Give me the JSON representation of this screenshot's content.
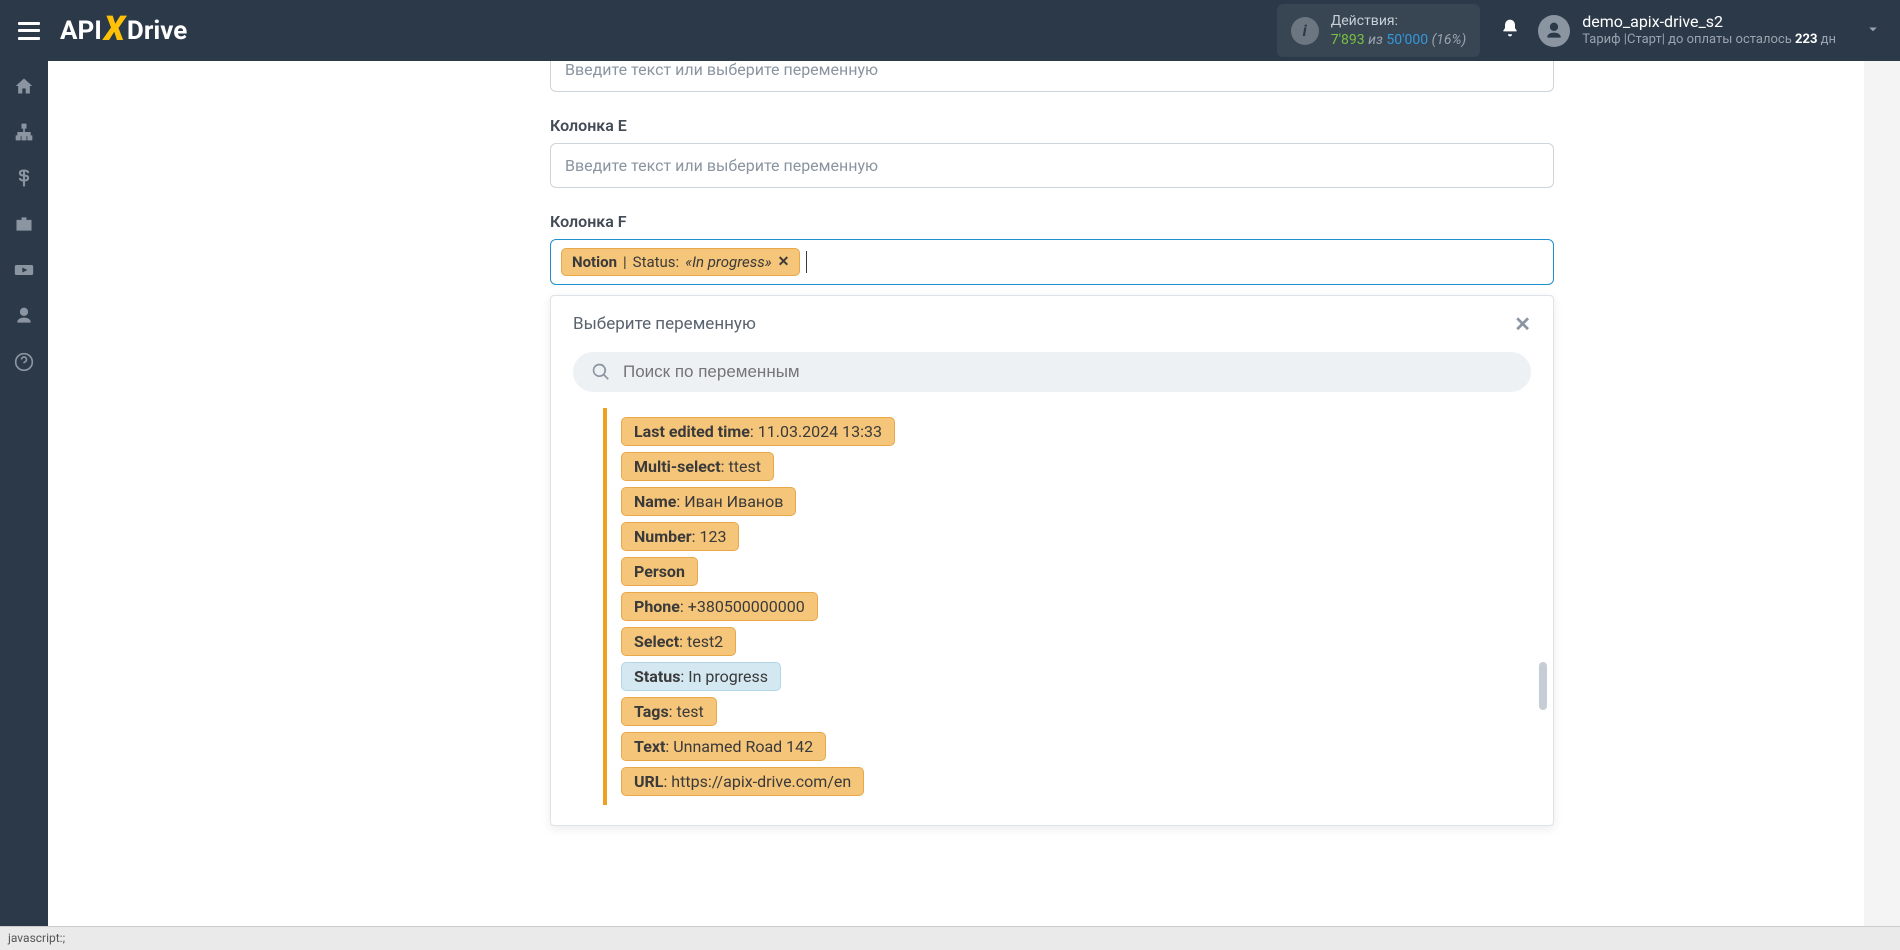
{
  "header": {
    "logo": {
      "part1": "API",
      "part2": "X",
      "part3": "Drive"
    },
    "actions": {
      "label": "Действия:",
      "used": "7'893",
      "iz": "из",
      "total": "50'000",
      "pct": "(16%)"
    },
    "user": {
      "name": "demo_apix-drive_s2",
      "tariff_prefix": "Тариф |Старт|  до оплаты осталось ",
      "days": "223",
      "days_suffix": " дн"
    }
  },
  "fields": {
    "prev_placeholder": "Введите текст или выберите переменную",
    "col_e": {
      "label": "Колонка E",
      "placeholder": "Введите текст или выберите переменную"
    },
    "col_f": {
      "label": "Колонка F",
      "tag_source": "Notion",
      "tag_sep": " | ",
      "tag_field": "Status: ",
      "tag_value": "«In progress»"
    }
  },
  "dropdown": {
    "title": "Выберите переменную",
    "search_placeholder": "Поиск по переменным",
    "items": [
      {
        "key": "Last edited time",
        "val": ": 11.03.2024 13:33",
        "highlight": false
      },
      {
        "key": "Multi-select",
        "val": ": ttest",
        "highlight": false
      },
      {
        "key": "Name",
        "val": ": Иван Иванов",
        "highlight": false
      },
      {
        "key": "Number",
        "val": ": 123",
        "highlight": false
      },
      {
        "key": "Person",
        "val": "",
        "highlight": false
      },
      {
        "key": "Phone",
        "val": ": +380500000000",
        "highlight": false
      },
      {
        "key": "Select",
        "val": ": test2",
        "highlight": false
      },
      {
        "key": "Status",
        "val": ": In progress",
        "highlight": true
      },
      {
        "key": "Tags",
        "val": ": test",
        "highlight": false
      },
      {
        "key": "Text",
        "val": ": Unnamed Road 142",
        "highlight": false
      },
      {
        "key": "URL",
        "val": ": https://apix-drive.com/en",
        "highlight": false
      }
    ]
  },
  "status_bar": "javascript:;"
}
